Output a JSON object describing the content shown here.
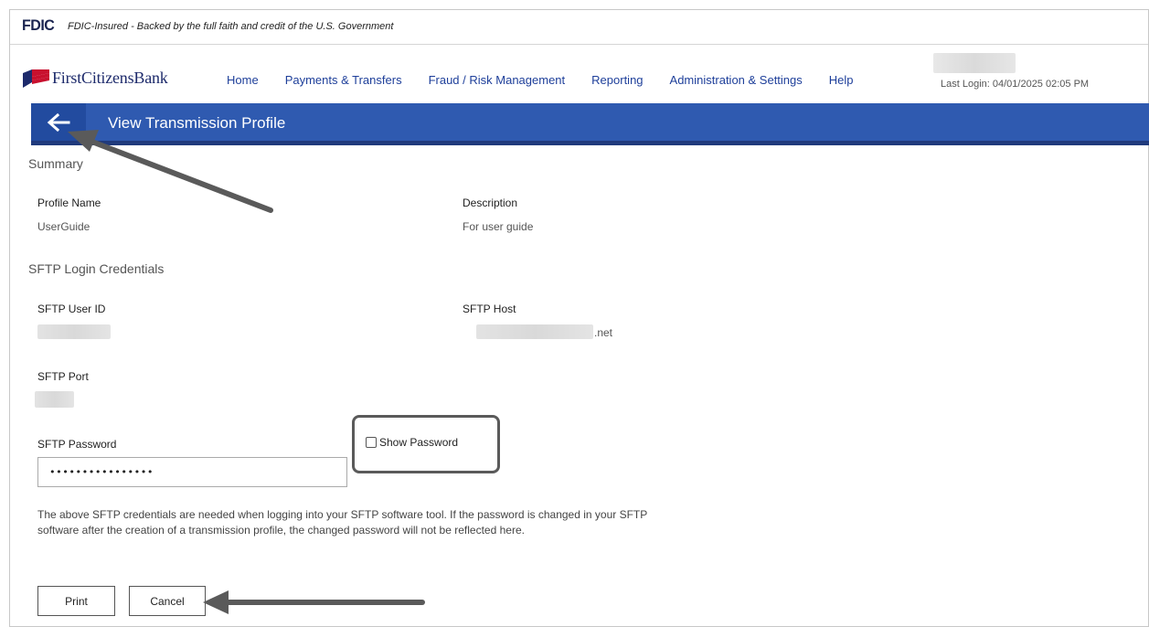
{
  "fdic": {
    "logo": "FDIC",
    "text": "FDIC-Insured - Backed by the full faith and credit of the U.S. Government"
  },
  "header": {
    "logo_text": "FirstCitizensBank",
    "nav": [
      "Home",
      "Payments & Transfers",
      "Fraud / Risk Management",
      "Reporting",
      "Administration & Settings",
      "Help"
    ],
    "last_login": "Last Login: 04/01/2025 02:05 PM"
  },
  "page": {
    "title": "View Transmission Profile"
  },
  "summary": {
    "heading": "Summary",
    "profile_name_label": "Profile Name",
    "profile_name_value": "UserGuide",
    "description_label": "Description",
    "description_value": "For user guide"
  },
  "sftp": {
    "heading": "SFTP Login Credentials",
    "user_id_label": "SFTP User ID",
    "host_label": "SFTP Host",
    "host_suffix": ".net",
    "port_label": "SFTP Port",
    "password_label": "SFTP Password",
    "password_value": "••••••••••••••••",
    "show_password_label": "Show Password",
    "note": "The above SFTP credentials are needed when logging into your SFTP software tool. If the password is changed in your SFTP software after the creation of a transmission profile, the changed password will not be reflected here."
  },
  "buttons": {
    "print": "Print",
    "cancel": "Cancel"
  },
  "colors": {
    "title_bar": "#2f5ab0",
    "title_bar_border": "#203a7c",
    "nav_link": "#1e3f9a",
    "annotation": "#5a5a5a"
  }
}
